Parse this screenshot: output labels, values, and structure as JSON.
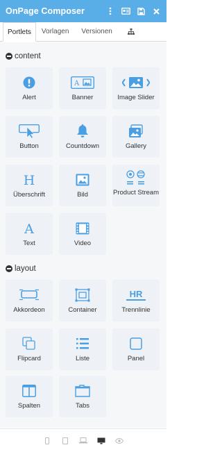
{
  "header": {
    "title": "OnPage Composer",
    "bg_color": "#5aaee8",
    "actions": [
      "more-vertical-icon",
      "card-icon",
      "save-icon",
      "close-icon"
    ]
  },
  "tabs": [
    {
      "label": "Portlets",
      "active": true
    },
    {
      "label": "Vorlagen",
      "active": false
    },
    {
      "label": "Versionen",
      "active": false
    },
    {
      "icon": "sitemap-icon",
      "active": false
    }
  ],
  "sections": [
    {
      "title": "content",
      "items": [
        {
          "label": "Alert",
          "icon": "alert-icon"
        },
        {
          "label": "Banner",
          "icon": "banner-icon"
        },
        {
          "label": "Image Slider",
          "icon": "image-slider-icon"
        },
        {
          "label": "Button",
          "icon": "button-icon"
        },
        {
          "label": "Countdown",
          "icon": "bell-icon"
        },
        {
          "label": "Gallery",
          "icon": "gallery-icon"
        },
        {
          "label": "Überschrift",
          "icon": "heading-icon"
        },
        {
          "label": "Bild",
          "icon": "image-icon"
        },
        {
          "label": "Product Stream",
          "icon": "product-stream-icon"
        },
        {
          "label": "Text",
          "icon": "text-icon"
        },
        {
          "label": "Video",
          "icon": "video-icon"
        }
      ]
    },
    {
      "title": "layout",
      "items": [
        {
          "label": "Akkordeon",
          "icon": "accordion-icon"
        },
        {
          "label": "Container",
          "icon": "container-icon"
        },
        {
          "label": "Trennlinie",
          "icon": "hr-icon"
        },
        {
          "label": "Flipcard",
          "icon": "flipcard-icon"
        },
        {
          "label": "Liste",
          "icon": "list-icon"
        },
        {
          "label": "Panel",
          "icon": "panel-icon"
        },
        {
          "label": "Spalten",
          "icon": "columns-icon"
        },
        {
          "label": "Tabs",
          "icon": "tabs-icon"
        }
      ]
    }
  ],
  "footer": {
    "devices": [
      "phone-icon",
      "tablet-icon",
      "laptop-icon",
      "desktop-icon",
      "eye-icon"
    ],
    "active": "desktop-icon"
  },
  "colors": {
    "accent": "#5aaee8",
    "icon": "#4a9fe3",
    "tile_bg": "#eef1f5"
  }
}
